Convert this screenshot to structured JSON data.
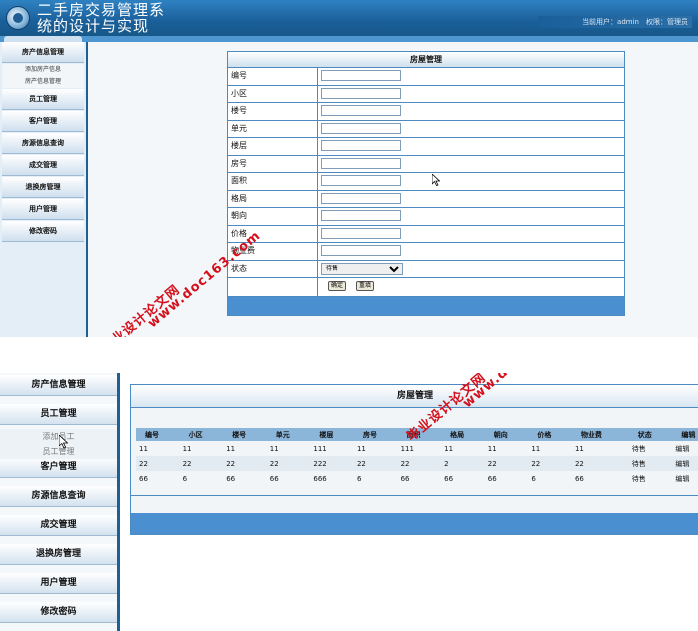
{
  "header": {
    "system_title_line1": "二手房交易管理系",
    "system_title_line2": "统的设计与实现",
    "current_user": "当前用户：admin　权限：管理员"
  },
  "top_sidebar": {
    "items": [
      {
        "label": "房产信息管理"
      },
      {
        "label": "添加房产信息",
        "sub": true
      },
      {
        "label": "房产信息管理",
        "sub": true
      },
      {
        "label": "员工管理"
      },
      {
        "label": "客户管理"
      },
      {
        "label": "房源信息查询"
      },
      {
        "label": "成交管理"
      },
      {
        "label": "退换房管理"
      },
      {
        "label": "用户管理"
      },
      {
        "label": "修改密码"
      }
    ]
  },
  "house_form": {
    "title": "房屋管理",
    "fields": [
      {
        "label": "编号",
        "value": ""
      },
      {
        "label": "小区",
        "value": ""
      },
      {
        "label": "楼号",
        "value": ""
      },
      {
        "label": "单元",
        "value": ""
      },
      {
        "label": "楼层",
        "value": ""
      },
      {
        "label": "房号",
        "value": ""
      },
      {
        "label": "面积",
        "value": ""
      },
      {
        "label": "格局",
        "value": ""
      },
      {
        "label": "朝向",
        "value": ""
      },
      {
        "label": "价格",
        "value": ""
      },
      {
        "label": "物业费",
        "value": ""
      }
    ],
    "status_label": "状态",
    "status_value": "待售",
    "confirm_label": "确定",
    "reset_label": "重填"
  },
  "bottom_sidebar": {
    "items": [
      {
        "label": "房产信息管理"
      },
      {
        "label": "员工管理"
      },
      {
        "label": "添加员工",
        "sub": true
      },
      {
        "label": "员工管理",
        "sub": true
      },
      {
        "label": "客户管理"
      },
      {
        "label": "房源信息查询"
      },
      {
        "label": "成交管理"
      },
      {
        "label": "退换房管理"
      },
      {
        "label": "用户管理"
      },
      {
        "label": "修改密码"
      }
    ]
  },
  "house_list": {
    "title": "房屋管理",
    "columns": [
      "编号",
      "小区",
      "楼号",
      "单元",
      "楼层",
      "房号",
      "面积",
      "格局",
      "朝向",
      "价格",
      "物业费",
      "状态",
      "编辑"
    ],
    "rows": [
      [
        "11",
        "11",
        "11",
        "11",
        "111",
        "11",
        "111",
        "11",
        "11",
        "11",
        "11",
        "待售",
        "编辑"
      ],
      [
        "22",
        "22",
        "22",
        "22",
        "222",
        "22",
        "22",
        "2",
        "22",
        "22",
        "22",
        "待售",
        "编辑"
      ],
      [
        "66",
        "6",
        "66",
        "66",
        "666",
        "6",
        "66",
        "66",
        "66",
        "6",
        "66",
        "待售",
        "编辑"
      ]
    ]
  },
  "watermark": {
    "text_cn": "毕业设计论文网",
    "text_url": "www.doc163.com"
  },
  "colors": {
    "header_blue": "#1a5f9a",
    "table_border": "#4c8ac2",
    "footer_blue": "#4a8fd0",
    "watermark_red": "#d4101c"
  }
}
